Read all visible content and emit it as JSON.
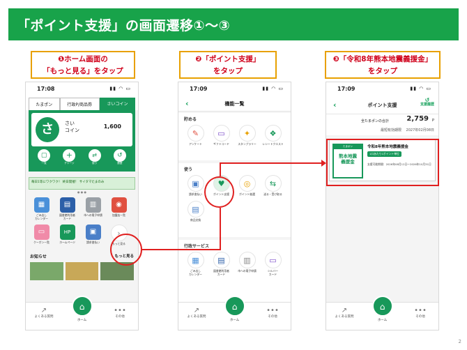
{
  "title": "「ポイント支援」の画面遷移①～③",
  "page_number": "2",
  "steps": [
    {
      "marker": "❶",
      "line1": "ホーム画面の",
      "line2": "「もっと見る」をタップ"
    },
    {
      "marker": "❷",
      "line1": "「ポイント支援」",
      "line2": "をタップ"
    },
    {
      "marker": "❸",
      "line1": "「令和8年熊本地震義援金」",
      "line2": "をタップ"
    }
  ],
  "phone1": {
    "time": "17:08",
    "tabs": [
      "たまポン",
      "行政P/商品券",
      "さいコイン"
    ],
    "coin_label": "さい\nコイン",
    "coin_balance": "1,600",
    "actions": [
      "一覧",
      "チャージ",
      "使う",
      "履歴"
    ],
    "banner_text": "毎日1等にワクワク！ 終日開催！ サイタマたまのみ",
    "grid": [
      "ごみ出し\nカレンダー",
      "図書館利用者\nカード",
      "市への電子申請",
      "加盟店一覧",
      "クーポン一覧",
      "ホームページ",
      "請求書払い",
      "もっと見る"
    ],
    "news_title": "お知らせ",
    "news_more": "もっと見る",
    "tabbar": [
      "よくある質問",
      "ホーム",
      "その他"
    ]
  },
  "phone2": {
    "time": "17:09",
    "nav_title": "機能一覧",
    "sec_save": "貯める",
    "save_items": [
      "アンケート",
      "ギフトコード",
      "スタンプラリー",
      "レシートクエスト"
    ],
    "sec_use": "使う",
    "use_items": [
      "請求書払い",
      "ポイント支援",
      "ポイント抽選",
      "送る・受け取る",
      "商品交換"
    ],
    "sec_admin": "行政サービス",
    "admin_items": [
      "ごみ出し\nカレンダー",
      "図書館利用者\nカード",
      "市への電子申請",
      "シルバー\nカード"
    ],
    "tabbar": [
      "よくある質問",
      "ホーム",
      "その他"
    ]
  },
  "phone3": {
    "time": "17:09",
    "nav_title": "ポイント支援",
    "history_label": "支援履歴",
    "total_label": "全たまポンの合計",
    "total_value": "2,759",
    "total_unit": "P",
    "expiry_label": "最短有効期限",
    "expiry_value": "2027年02月08日",
    "card_title": "令和8年熊本地震義援金",
    "card_tag": "1口あたり1ポイント単位",
    "card_period": "支援可能期間：2026年08月12日～2026年10月31日",
    "thumb_text": "熊本地震\n義援金",
    "tabbar": [
      "よくある質問",
      "ホーム",
      "その他"
    ]
  },
  "colors": {
    "brand_green": "#18a34a",
    "highlight_red": "#e02020",
    "caption_border": "#e8a000"
  }
}
